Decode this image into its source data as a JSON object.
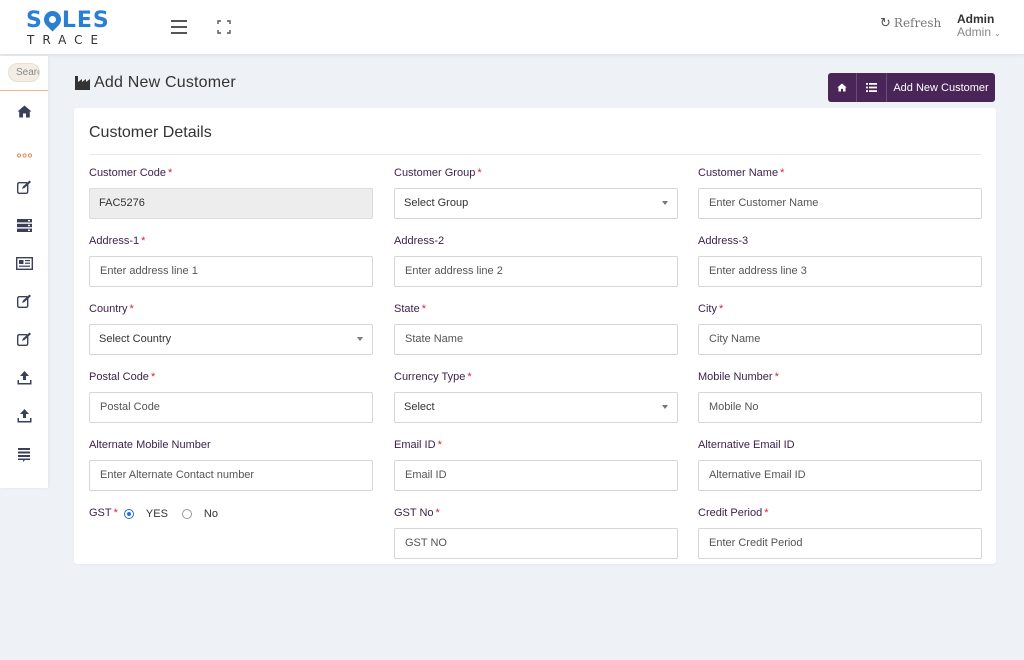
{
  "app": {
    "logo_top_left": "S",
    "logo_top_right": "LES",
    "logo_bottom": "TRACE"
  },
  "topbar": {
    "refresh_label": "Refresh",
    "user_name": "Admin",
    "user_role": "Admin"
  },
  "sidebar": {
    "search_placeholder": "Search"
  },
  "page": {
    "title": "Add New Customer",
    "add_button_label": "Add New Customer"
  },
  "card": {
    "title": "Customer Details"
  },
  "form": {
    "customer_code": {
      "label": "Customer Code",
      "value": "FAC5276"
    },
    "customer_group": {
      "label": "Customer Group",
      "value": "Select Group"
    },
    "customer_name": {
      "label": "Customer Name",
      "placeholder": "Enter Customer  Name"
    },
    "address1": {
      "label": "Address-1",
      "placeholder": "Enter address line 1"
    },
    "address2": {
      "label": "Address-2",
      "placeholder": "Enter address line 2"
    },
    "address3": {
      "label": "Address-3",
      "placeholder": "Enter address line 3"
    },
    "country": {
      "label": "Country",
      "value": "Select Country"
    },
    "state": {
      "label": "State",
      "placeholder": "State Name"
    },
    "city": {
      "label": "City",
      "placeholder": "City Name"
    },
    "postal_code": {
      "label": "Postal Code",
      "placeholder": "Postal Code"
    },
    "currency_type": {
      "label": "Currency Type",
      "value": "Select"
    },
    "mobile_number": {
      "label": "Mobile Number",
      "placeholder": "Mobile No"
    },
    "alt_mobile": {
      "label": "Alternate Mobile Number",
      "placeholder": "Enter Alternate Contact number"
    },
    "email": {
      "label": "Email ID",
      "placeholder": "Email ID"
    },
    "alt_email": {
      "label": "Alternative Email ID",
      "placeholder": "Alternative Email ID"
    },
    "gst": {
      "label": "GST",
      "option_yes": "YES",
      "option_no": "No",
      "selected": "YES"
    },
    "gst_no": {
      "label": "GST No",
      "placeholder": "GST NO"
    },
    "credit_period": {
      "label": "Credit Period",
      "placeholder": "Enter Credit Period"
    }
  },
  "colors": {
    "brand_blue": "#2a7fd4",
    "primary_purple": "#4a2557",
    "required_red": "#d2243c",
    "label_purple": "#3b1f48"
  }
}
